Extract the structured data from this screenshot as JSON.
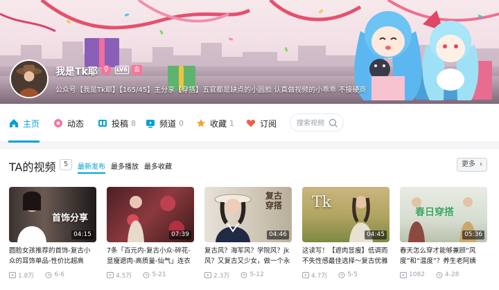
{
  "user": {
    "name": "我是Tk耶",
    "level": "LV6",
    "vip_badge": "会",
    "sex_badge": "♀",
    "sign": "公众号【我是Tk耶】【165/45】主分享【穿搭】五官都是缺点的小圆脸 认真做视频的小乖乖 不接硬商"
  },
  "nav": {
    "items": [
      {
        "label": "主页",
        "count": "",
        "icon": "home-icon",
        "active": true
      },
      {
        "label": "动态",
        "count": "",
        "icon": "dynamic-icon"
      },
      {
        "label": "投稿",
        "count": "8",
        "icon": "upload-icon"
      },
      {
        "label": "频道",
        "count": "0",
        "icon": "channel-icon"
      },
      {
        "label": "收藏",
        "count": "1",
        "icon": "star-icon"
      },
      {
        "label": "订阅",
        "count": "",
        "icon": "heart-icon"
      }
    ],
    "search_placeholder": "搜索视频"
  },
  "section": {
    "title": "TA的视频",
    "count": "5",
    "tabs": [
      "最新发布",
      "最多播放",
      "最多收藏"
    ],
    "more_label": "更多",
    "more_chevron": "›"
  },
  "videos": [
    {
      "overlay": "首饰分享",
      "duration": "04:15",
      "title": "圆脸女孩推荐的首饰-复古小众的耳饰单品-性价比超高",
      "plays": "1.8万",
      "danmaku": "6-6"
    },
    {
      "overlay": "",
      "duration": "07:39",
      "title": "7条「百元内-复古小众-碎花-显瘦遮肉-高质量-仙气」连衣",
      "plays": "4.5万",
      "danmaku": "5-21"
    },
    {
      "overlay": "复古穿搭",
      "duration": "04:46",
      "title": "复古风？海军风？学院风？jk风？又复古又少女，做一个永",
      "plays": "2.3万",
      "danmaku": "5-12"
    },
    {
      "overlay": "Tk",
      "duration": "04:45",
      "title": "这读写！【遮肉显瘦】低调而不失性感最佳选择～复古优雅",
      "plays": "4.7万",
      "danmaku": "5-5"
    },
    {
      "overlay": "春日穿搭",
      "duration": "05:36",
      "title": "春天怎么穿才能够兼顾“风度”和“温度”？养生老阿姨",
      "plays": "1082",
      "danmaku": "4-28"
    }
  ],
  "colors": {
    "accent": "#00a1d6",
    "pink": "#fb7299"
  }
}
